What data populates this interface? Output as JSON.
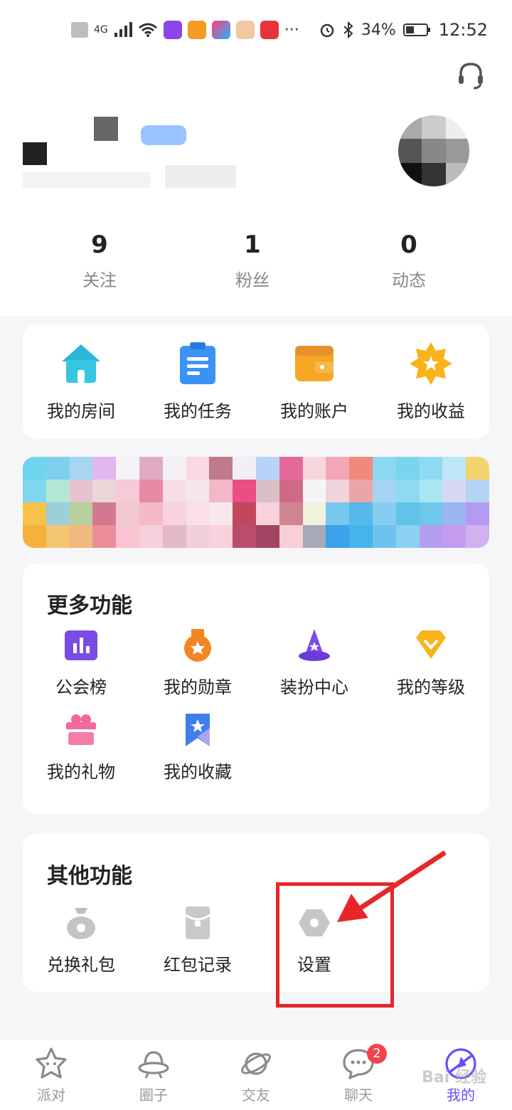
{
  "status_bar": {
    "network": "4G",
    "battery": "34%",
    "time": "12:52",
    "more": "···"
  },
  "stats": [
    {
      "num": "9",
      "label": "关注"
    },
    {
      "num": "1",
      "label": "粉丝"
    },
    {
      "num": "0",
      "label": "动态"
    }
  ],
  "quick": [
    {
      "label": "我的房间"
    },
    {
      "label": "我的任务"
    },
    {
      "label": "我的账户"
    },
    {
      "label": "我的收益"
    }
  ],
  "more_section": {
    "title": "更多功能",
    "items": [
      {
        "label": "公会榜"
      },
      {
        "label": "我的勋章"
      },
      {
        "label": "装扮中心"
      },
      {
        "label": "我的等级"
      },
      {
        "label": "我的礼物"
      },
      {
        "label": "我的收藏"
      }
    ]
  },
  "other_section": {
    "title": "其他功能",
    "items": [
      {
        "label": "兑换礼包"
      },
      {
        "label": "红包记录"
      },
      {
        "label": "设置"
      }
    ]
  },
  "tabs": [
    {
      "label": "派对"
    },
    {
      "label": "圈子"
    },
    {
      "label": "交友"
    },
    {
      "label": "聊天",
      "badge": "2"
    },
    {
      "label": "我的"
    }
  ],
  "colors": {
    "accent": "#6b4cff",
    "highlight": "#e8262a",
    "badge": "#f3434d"
  },
  "watermark": "Bai 经验"
}
